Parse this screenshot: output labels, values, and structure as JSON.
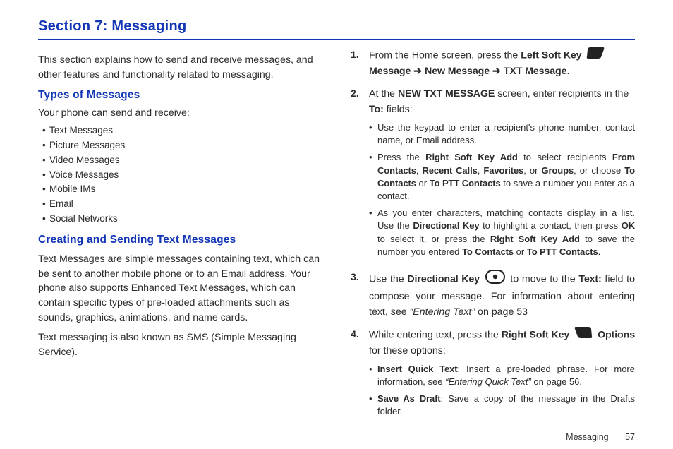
{
  "section_title": "Section 7:  Messaging",
  "intro": "This section explains how to send and receive messages, and other features and functionality related to messaging.",
  "types_head": "Types of Messages",
  "types_intro": "Your phone can send and receive:",
  "types_list": [
    "Text Messages",
    "Picture Messages",
    "Video Messages",
    "Voice Messages",
    "Mobile IMs",
    "Email",
    "Social Networks"
  ],
  "creating_head": "Creating and Sending Text Messages",
  "creating_p1": "Text Messages are simple messages containing text, which can be sent to another mobile phone or to an Email address. Your phone also supports Enhanced Text Messages, which can contain specific types of pre-loaded attachments such as sounds, graphics, animations, and name cards.",
  "creating_p2": "Text messaging is also known as SMS (Simple Messaging Service).",
  "step1": {
    "pre": "From the Home screen, press the ",
    "lsk": "Left Soft Key",
    "line2a": "Message",
    "arrow": "➔",
    "line2b": "New Message",
    "line2c": "TXT Message",
    "period": "."
  },
  "step2": {
    "pre": "At the ",
    "scr": "NEW TXT MESSAGE",
    "post": "  screen, enter recipients in the ",
    "to": "To:",
    "fields": " fields:",
    "b1": "Use the keypad to enter a recipient's phone number, contact name, or Email address.",
    "b2_pre": "Press the ",
    "b2_rsk": "Right Soft Key Add",
    "b2_mid": " to select recipients ",
    "b2_fc": "From Contacts",
    "b2_comma": ", ",
    "b2_rc": "Recent Calls",
    "b2_fav": "Favorites",
    "b2_or": ", or ",
    "b2_grp": "Groups",
    "b2_choose": ", or choose ",
    "b2_tc": "To Contacts",
    "b2_or2": " or ",
    "b2_tptt": "To PTT Contacts",
    "b2_end": " to save a number you enter as a contact.",
    "b3_pre": "As you enter characters, matching contacts display in a list. Use the ",
    "b3_dk": "Directional Key",
    "b3_mid": " to highlight a contact, then press ",
    "b3_ok": "OK",
    "b3_mid2": " to select it, or press the ",
    "b3_rsk": "Right Soft Key Add",
    "b3_mid3": " to save the number you entered ",
    "b3_tc": "To Contacts",
    "b3_or": " or ",
    "b3_tptt": "To PTT Contacts",
    "b3_end": "."
  },
  "step3": {
    "pre": "Use the ",
    "dk": "Directional Key",
    "mid": " to move to the ",
    "text": "Text:",
    "mid2": " field to compose your message. For information about entering text, see ",
    "quote": "“Entering Text”",
    "page": " on page 53"
  },
  "step4": {
    "pre": "While entering text, press the ",
    "rsk": "Right Soft Key",
    "opts": "Options",
    "post": " for these options:",
    "b1_head": "Insert Quick Text",
    "b1_body": ": Insert a pre-loaded phrase. For more information, see ",
    "b1_quote": "“Entering Quick Text”",
    "b1_page": " on page 56.",
    "b2_head": "Save As Draft",
    "b2_body": ": Save a copy of the message in the Drafts folder."
  },
  "footer_label": "Messaging",
  "footer_page": "57"
}
